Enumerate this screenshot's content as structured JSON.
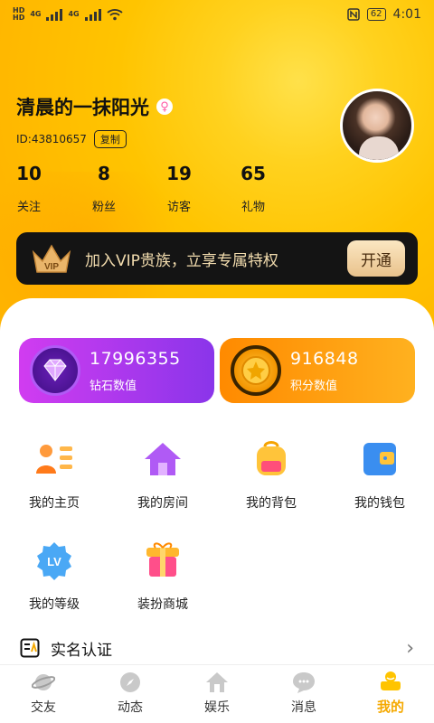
{
  "status_bar": {
    "hd1": "HD",
    "hd2": "HD",
    "net1": "4G",
    "net2": "4G",
    "battery": "62",
    "time": "4:01"
  },
  "profile": {
    "name": "清晨的一抹阳光",
    "gender_symbol": "♀",
    "id_text": "ID:43810657",
    "copy_label": "复制",
    "stats": [
      {
        "value": "10",
        "label": "关注"
      },
      {
        "value": "8",
        "label": "粉丝"
      },
      {
        "value": "19",
        "label": "访客"
      },
      {
        "value": "65",
        "label": "礼物"
      }
    ]
  },
  "vip": {
    "badge": "VIP",
    "text": "加入VIP贵族，立享专属特权",
    "button": "开通"
  },
  "wallets": {
    "diamond": {
      "value": "17996355",
      "label": "钻石数值"
    },
    "points": {
      "value": "916848",
      "label": "积分数值"
    }
  },
  "menu": [
    {
      "label": "我的主页",
      "icon": "profile-card-icon"
    },
    {
      "label": "我的房间",
      "icon": "house-icon"
    },
    {
      "label": "我的背包",
      "icon": "backpack-icon"
    },
    {
      "label": "我的钱包",
      "icon": "wallet-icon"
    },
    {
      "label": "我的等级",
      "icon": "level-badge-icon"
    },
    {
      "label": "装扮商城",
      "icon": "gift-box-icon"
    }
  ],
  "level_badge": "LV",
  "realname": {
    "label": "实名认证",
    "chevron": "›"
  },
  "tabs": [
    {
      "label": "交友",
      "icon": "planet-icon"
    },
    {
      "label": "动态",
      "icon": "compass-icon"
    },
    {
      "label": "娱乐",
      "icon": "home-icon"
    },
    {
      "label": "消息",
      "icon": "chat-icon"
    },
    {
      "label": "我的",
      "icon": "user-icon",
      "active": true
    }
  ],
  "colors": {
    "brand_yellow": "#ffc400",
    "vip_gold": "#f2dcae",
    "active_tab": "#f5a900"
  }
}
